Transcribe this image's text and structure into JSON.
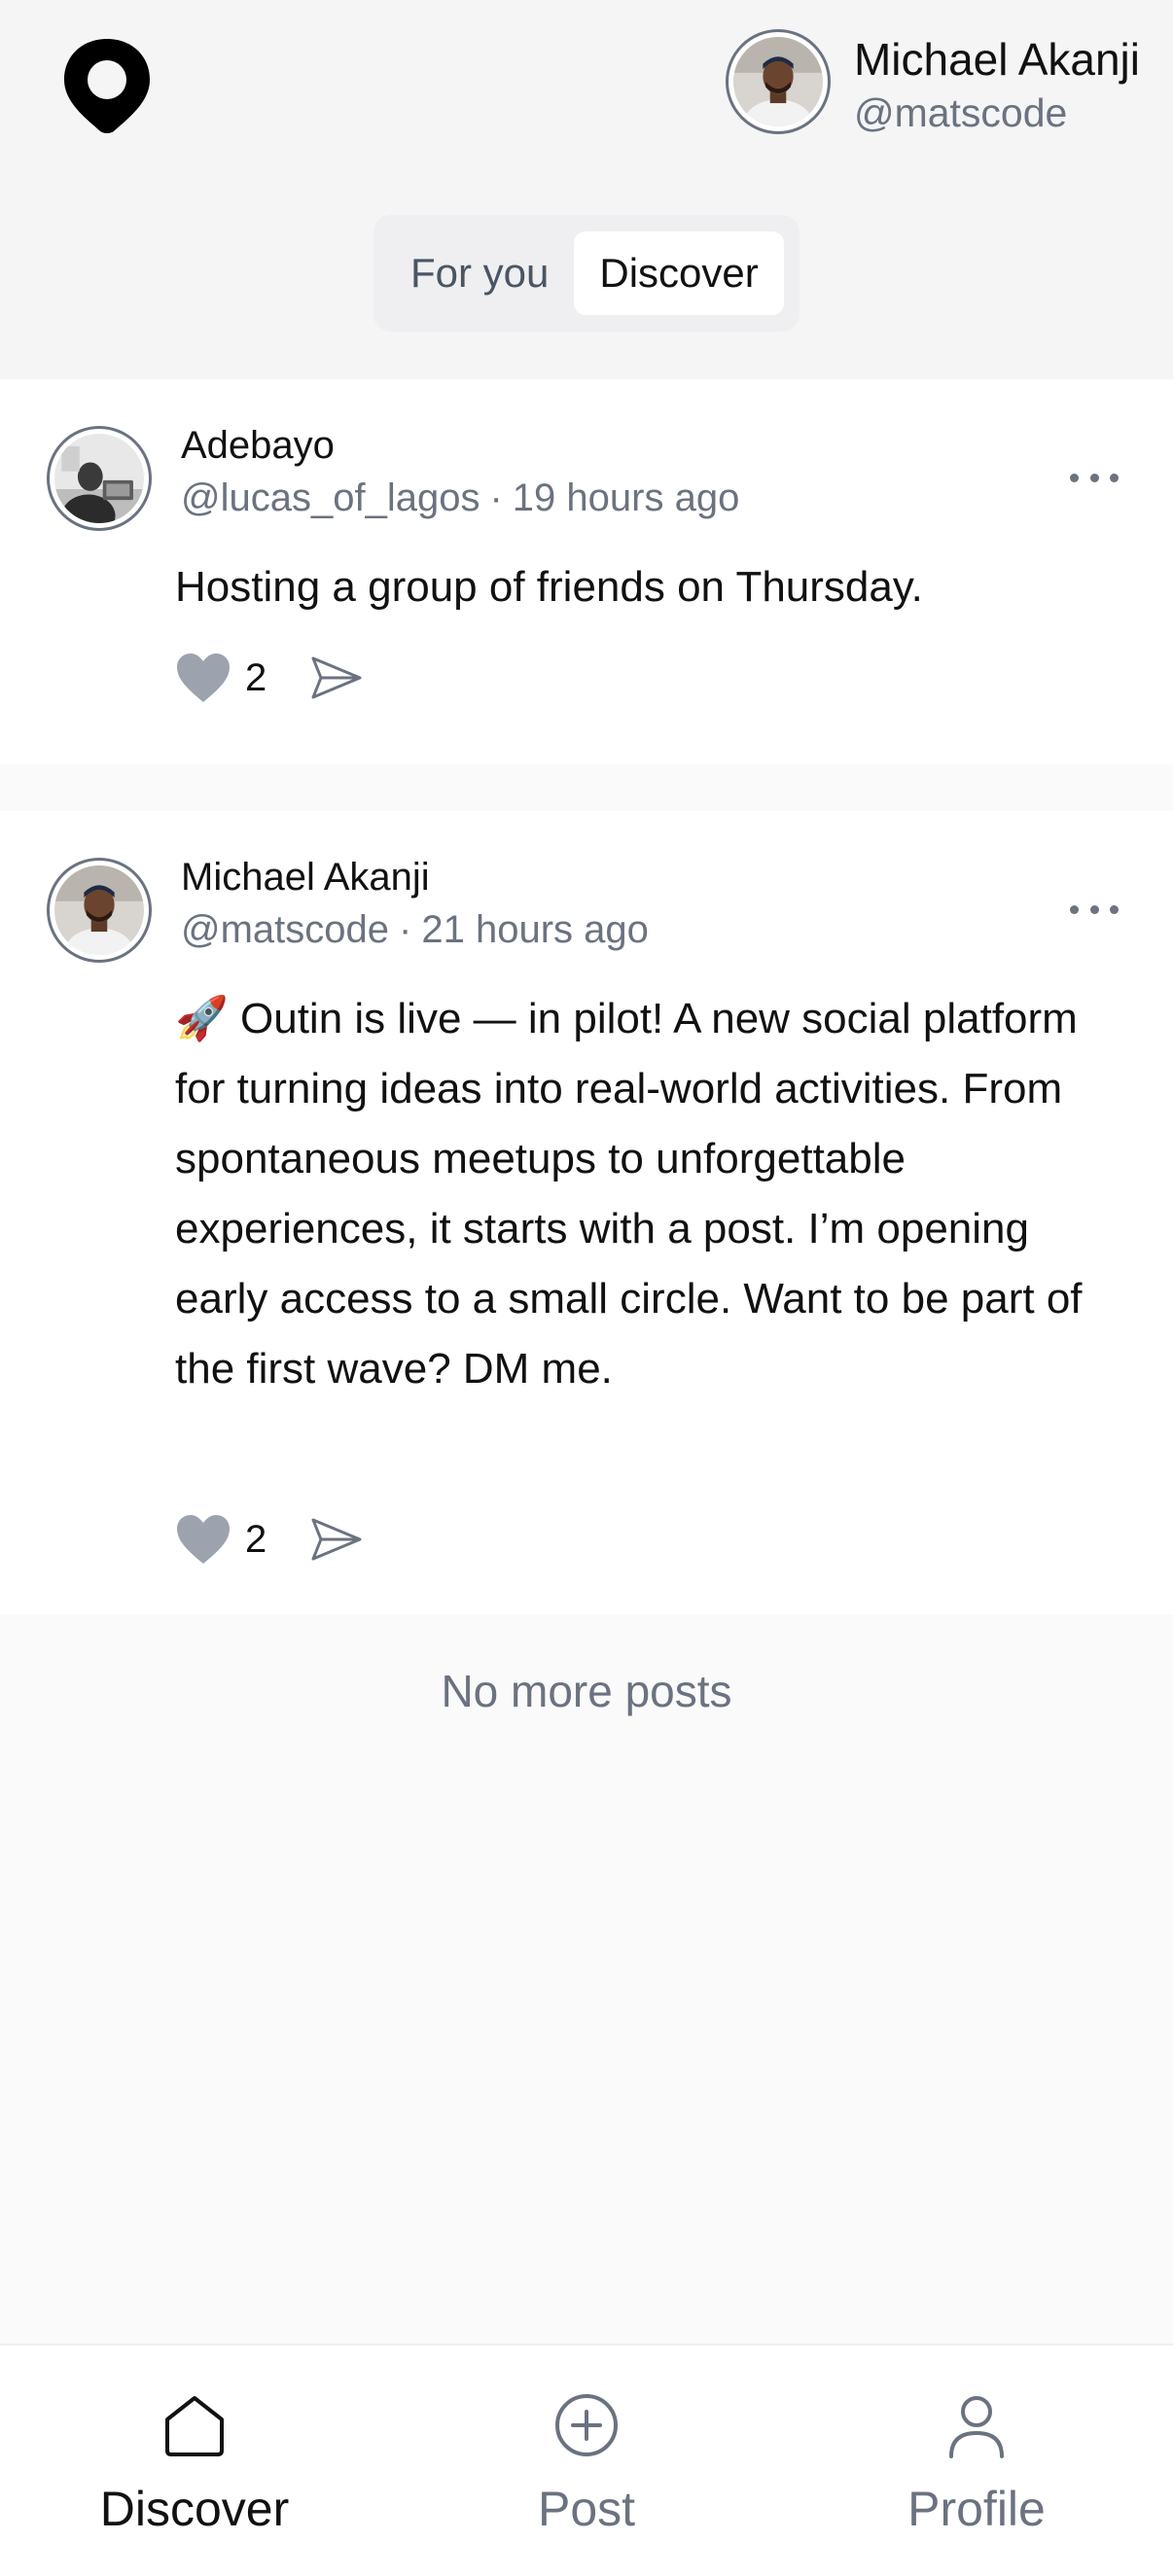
{
  "header": {
    "logo_icon": "location-pin-logo",
    "user": {
      "name": "Michael Akanji",
      "handle": "@matscode"
    },
    "tabs": [
      {
        "label": "For you",
        "active": false
      },
      {
        "label": "Discover",
        "active": true
      }
    ]
  },
  "posts": [
    {
      "author": "Adebayo",
      "handle": "@lucas_of_lagos",
      "separator": "·",
      "time": "19 hours ago",
      "text": "Hosting a group of friends on Thursday.",
      "likes": "2"
    },
    {
      "author": "Michael Akanji",
      "handle": "@matscode",
      "separator": "·",
      "time": "21 hours ago",
      "text": "🚀 Outin is live — in pilot! A new social platform for turning ideas into real-world activities. From spontaneous meetups to unforgettable experiences, it starts with a post. I’m opening early access to a small circle. Want to be part of the first wave? DM me.",
      "likes": "2"
    }
  ],
  "feed_end": "No more posts",
  "bottom_nav": [
    {
      "label": "Discover",
      "icon": "home-icon",
      "active": true
    },
    {
      "label": "Post",
      "icon": "plus-circle-icon",
      "active": false
    },
    {
      "label": "Profile",
      "icon": "user-icon",
      "active": false
    }
  ],
  "colors": {
    "background": "#fafafa",
    "card": "#ffffff",
    "muted_text": "#6b7280",
    "heart": "#9ca3af"
  }
}
